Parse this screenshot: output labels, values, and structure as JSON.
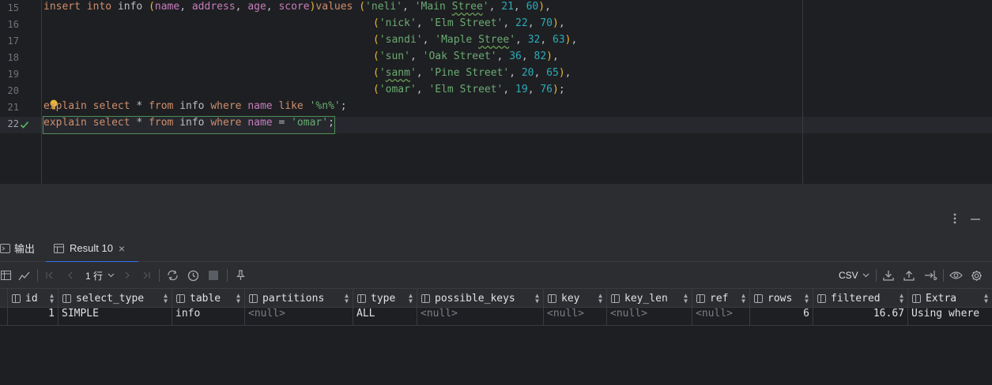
{
  "editor": {
    "line_numbers": [
      "15",
      "16",
      "17",
      "18",
      "19",
      "20",
      "21",
      "22"
    ],
    "lines": {
      "l15": {
        "kw1": "insert into",
        "t1": " info ",
        "p1": "(",
        "c1": "name",
        "t2": ", ",
        "c2": "address",
        "t3": ", ",
        "c3": "age",
        "t4": ", ",
        "c4": "score",
        "p2": ")",
        "kw2": "values",
        "t5": " ",
        "p3": "(",
        "s1": "'neli'",
        "t6": ", ",
        "s2a": "'Main ",
        "s2b": "Stree",
        "s2c": "'",
        "t7": ", ",
        "n1": "21",
        "t8": ", ",
        "n2": "60",
        "p4": ")",
        "t9": ","
      },
      "l16": {
        "p1": "(",
        "s1": "'nick'",
        "t1": ", ",
        "s2": "'Elm Street'",
        "t2": ", ",
        "n1": "22",
        "t3": ", ",
        "n2": "70",
        "p2": ")",
        "t4": ","
      },
      "l17": {
        "p1": "(",
        "s1": "'sandi'",
        "t1": ", ",
        "s2a": "'Maple ",
        "s2b": "Stree",
        "s2c": "'",
        "t2": ", ",
        "n1": "32",
        "t3": ", ",
        "n2": "63",
        "p2": ")",
        "t4": ","
      },
      "l18": {
        "p1": "(",
        "s1": "'sun'",
        "t1": ", ",
        "s2": "'Oak Street'",
        "t2": ", ",
        "n1": "36",
        "t3": ", ",
        "n2": "82",
        "p2": ")",
        "t4": ","
      },
      "l19": {
        "p1": "(",
        "s1a": "'",
        "s1b": "sanm",
        "s1c": "'",
        "t1": ", ",
        "s2": "'Pine Street'",
        "t2": ", ",
        "n1": "20",
        "t3": ", ",
        "n2": "65",
        "p2": ")",
        "t4": ","
      },
      "l20": {
        "p1": "(",
        "s1": "'omar'",
        "t1": ", ",
        "s2": "'Elm Street'",
        "t2": ", ",
        "n1": "19",
        "t3": ", ",
        "n2": "76",
        "p2": ")",
        "t4": ";"
      },
      "l21": {
        "kw1": "explain select",
        "t1": " * ",
        "kw2": "from",
        "t2": " info ",
        "kw3": "where",
        "t3": " ",
        "c1": "name",
        "t4": " ",
        "kw4": "like",
        "t5": " ",
        "s1": "'%n%'",
        "t6": ";"
      },
      "l22": {
        "kw1": "explain select",
        "t1": " * ",
        "kw2": "from",
        "t2": " info ",
        "kw3": "where",
        "t3": " ",
        "c1": "name",
        "t4": " = ",
        "s1": "'omar'",
        "t5": ";"
      }
    }
  },
  "panel": {
    "tabs": [
      {
        "label": "输出"
      },
      {
        "label": "Result 10",
        "close": "×"
      }
    ],
    "toolbar": {
      "row_count": "1 行",
      "export_format": "CSV"
    },
    "columns": [
      {
        "label": "id"
      },
      {
        "label": "select_type"
      },
      {
        "label": "table"
      },
      {
        "label": "partitions"
      },
      {
        "label": "type"
      },
      {
        "label": "possible_keys"
      },
      {
        "label": "key"
      },
      {
        "label": "key_len"
      },
      {
        "label": "ref"
      },
      {
        "label": "rows"
      },
      {
        "label": "filtered"
      },
      {
        "label": "Extra"
      }
    ],
    "rows": [
      [
        "1",
        "SIMPLE",
        "info",
        "<null>",
        "ALL",
        "<null>",
        "<null>",
        "<null>",
        "<null>",
        "6",
        "16.67",
        "Using where"
      ]
    ]
  },
  "colors": {
    "accent": "#3574f0",
    "keyword": "#cf8e6d",
    "string": "#6aab73",
    "number": "#2aacb8",
    "column": "#c77dbb"
  }
}
